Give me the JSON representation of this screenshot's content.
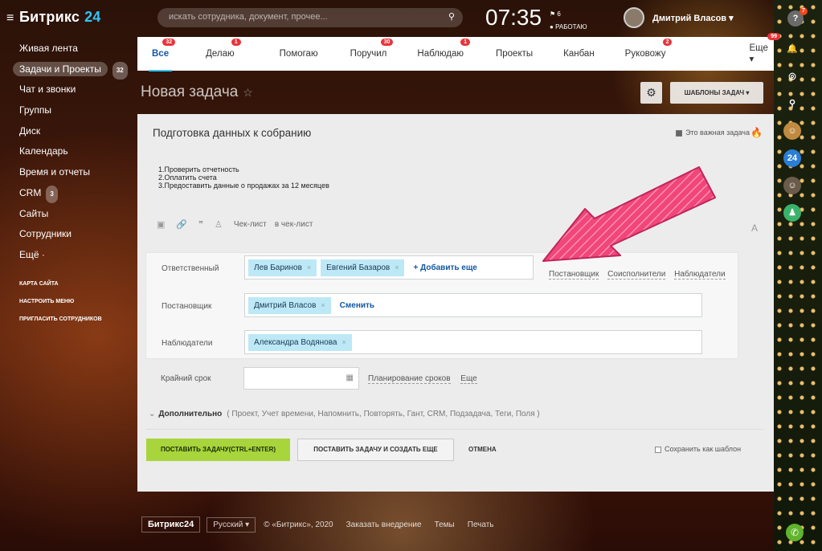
{
  "app": {
    "logo": "Битрикс",
    "logo_num": "24"
  },
  "topbar": {
    "search_placeholder": "искать сотрудника, документ, прочее...",
    "time": "07:35",
    "seconds_label": "6",
    "status": "РАБОТАЮ",
    "user_name": "Дмитрий Власов",
    "help_label": "?",
    "help_badge": "7"
  },
  "leftmenu": {
    "items": [
      {
        "label": "Живая лента"
      },
      {
        "label": "Задачи и Проекты",
        "count": "32"
      },
      {
        "label": "Чат и звонки"
      },
      {
        "label": "Группы"
      },
      {
        "label": "Диск"
      },
      {
        "label": "Календарь"
      },
      {
        "label": "Время и отчеты"
      },
      {
        "label": "CRM",
        "count": "3"
      },
      {
        "label": "Сайты"
      },
      {
        "label": "Сотрудники"
      },
      {
        "label": "Ещё"
      }
    ],
    "small": [
      "КАРТА САЙТА",
      "НАСТРОИТЬ МЕНЮ",
      "ПРИГЛАСИТЬ СОТРУДНИКОВ"
    ]
  },
  "tabs": [
    {
      "label": "Все",
      "badge": "32"
    },
    {
      "label": "Делаю",
      "badge": "1"
    },
    {
      "label": "Помогаю",
      "badge": ""
    },
    {
      "label": "Поручил",
      "badge": "30"
    },
    {
      "label": "Наблюдаю",
      "badge": "1"
    },
    {
      "label": "Проекты",
      "badge": ""
    },
    {
      "label": "Канбан",
      "badge": ""
    },
    {
      "label": "Руковожу",
      "badge": "2"
    },
    {
      "label": "Еще",
      "badge": "99"
    }
  ],
  "page": {
    "title": "Новая задача",
    "templates_button": "ШАБЛОНЫ ЗАДАЧ"
  },
  "task": {
    "title": "Подготовка данных к собранию",
    "important_label": "Это важная задача",
    "description": [
      "1.Проверить отчетность",
      "2.Оплатить счета",
      "3.Предоставить данные о продажах за 12 месяцев"
    ],
    "editor_checklist": "Чек-лист",
    "editor_in_checklist": "в чек-лист",
    "font_label": "A"
  },
  "people": {
    "responsible_label": "Ответственный",
    "responsible": [
      "Лев Баринов",
      "Евгений Базаров"
    ],
    "add_more": "+ Добавить еще",
    "side_links": [
      "Постановщик",
      "Соисполнители",
      "Наблюдатели"
    ],
    "creator_label": "Постановщик",
    "creator": "Дмитрий Власов",
    "change_label": "Сменить",
    "observers_label": "Наблюдатели",
    "observers": [
      "Александра Водянова"
    ]
  },
  "deadline": {
    "label": "Крайний срок",
    "planning": "Планирование сроков",
    "more": "Еще"
  },
  "extra": {
    "label": "Дополнительно",
    "items": "( Проект, Учет времени, Напомнить, Повторять, Гант, CRM, Подзадача, Теги, Поля )"
  },
  "actions": {
    "submit": "ПОСТАВИТЬ ЗАДАЧУ(CTRL+ENTER)",
    "submit_more": "ПОСТАВИТЬ ЗАДАЧУ И СОЗДАТЬ ЕЩЕ",
    "cancel": "ОТМЕНА",
    "save_template": "Сохранить как шаблон"
  },
  "rightbar": {
    "badge_24": "24"
  },
  "footer": {
    "logo": "Битрикс24",
    "lang": "Русский",
    "copyright": "© «Битрикс», 2020",
    "links": [
      "Заказать внедрение",
      "Темы",
      "Печать"
    ]
  },
  "colors": {
    "accent": "#2fc6f6",
    "submit": "#a8d53b",
    "badge": "#e8343a",
    "arrow": "#f0467a"
  }
}
